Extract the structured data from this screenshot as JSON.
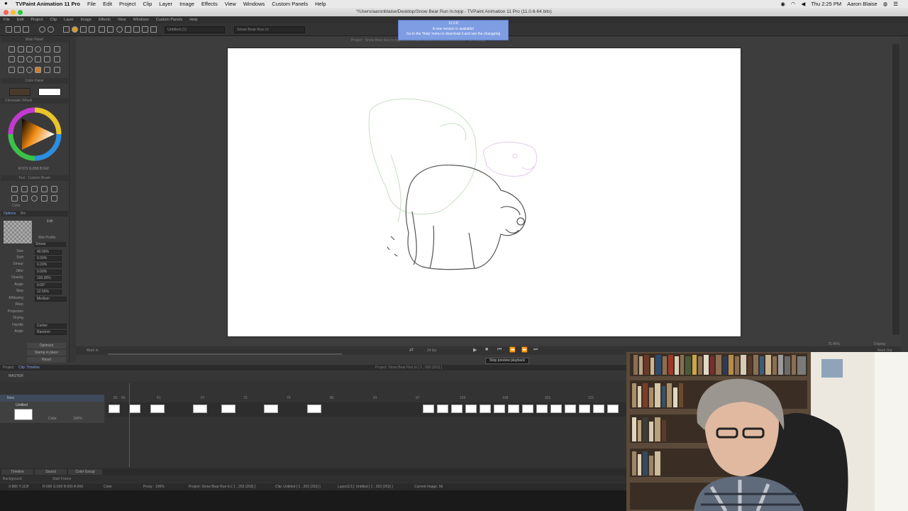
{
  "menubar": {
    "app_name": "TVPaint Animation 11 Pro",
    "items": [
      "File",
      "Edit",
      "Project",
      "Clip",
      "Layer",
      "Image",
      "Effects",
      "View",
      "Windows",
      "Custom Panels",
      "Help"
    ],
    "clock": "Thu 2:25 PM",
    "user": "Aaron Blaise"
  },
  "window": {
    "title": "*/Users/aaronblaise/Desktop/Snow Bear Run In.tvpp - TVPaint Animation 11 Pro (11.0.6-64 bits)"
  },
  "app_menu": [
    "File",
    "Edit",
    "Project",
    "Clip",
    "Layer",
    "Image",
    "Effects",
    "View",
    "Windows",
    "Custom Panels",
    "Help"
  ],
  "toolbar": {
    "layer_field": "Untitled (1)",
    "project_field": "Snow Bear Run In"
  },
  "popup": {
    "version": "11.0.8",
    "line1": "A new version is available!",
    "line2": "Go to the 'Help' menu to download it and see the changelog"
  },
  "left_panel": {
    "main_panel": "Main Panel",
    "color_panel": "Color Panel",
    "chromatic_wheel": "Chromatic Wheel",
    "rgb_readout": "R:073 G:058 B:042",
    "tool_panel": "Tool : Custom Brush",
    "color_label": "Color",
    "options_tab": "Options",
    "bin_tab": "Bin",
    "edit_label": "Edit",
    "wet_profile": "Wet Profile",
    "smear": "Smear",
    "params": [
      {
        "label": "Size",
        "value": "40.00%"
      },
      {
        "label": "Shift",
        "value": "0.00%"
      },
      {
        "label": "Smear",
        "value": "0.20%"
      },
      {
        "label": "Jitter",
        "value": "0.00%"
      },
      {
        "label": "Opacity",
        "value": "100.00%"
      },
      {
        "label": "Angle",
        "value": "0.00°"
      },
      {
        "label": "Step",
        "value": "12.50%"
      }
    ],
    "aaliasing_label": "AAliasing",
    "aaliasing_value": "Medium",
    "warp_label": "Warp",
    "projection_label": "Projection",
    "drying_label": "Drying",
    "handle_label": "Handle",
    "handle_value": "Center",
    "angle2_label": "Angle",
    "angle2_value": "Random",
    "optimize": "Optimize",
    "stamp": "Stamp in place",
    "reset": "Reset"
  },
  "project_path": "Project : Snow Bear Run In.tvpp (/Users/aaronblaise/Desktop/Snow Bear Run In.tvpp)",
  "image_info": "Image: 56",
  "zoom": "75.46%",
  "display": "Display",
  "mark_out": "Mark Out",
  "mark_in": "Mark In",
  "fps": "24 fps",
  "tooltip": "Stop preview playback",
  "timeline": {
    "tab_project": "Project",
    "tab_clip": "Clip: Timeline",
    "master": "MASTER",
    "project_info": "Project: Snow Bear Run In [ 1 , 263 (263) ]",
    "clip_info": "Clip: Untitled [ 1 , 263 (263) ]",
    "layer_info": "Layer(1/1): Untitled [ 1 , 263 (263) ]",
    "current_image": "Current Image: 56",
    "layer_name": "Untitled",
    "color_label": "Color",
    "opacity": "100%",
    "new_label": "New",
    "frame_numbers": [
      "55",
      "56",
      "61",
      "67",
      "73",
      "79",
      "85",
      "91",
      "97",
      "103",
      "109",
      "115",
      "121"
    ],
    "timeline_label": "Timeline",
    "sound_label": "Sound",
    "color_group": "Color Group",
    "background": "Background",
    "start_frame": "Start Frame"
  },
  "statusbar": {
    "coords": "X:865 Y:113f",
    "rgba": "R:000 G:000 B:000 A:000",
    "color": "Color",
    "proxy": "Proxy : 100%",
    "project": "Project: Snow Bear Run In [ 1 , 263 (263) ]",
    "clip": "Clip: Untitled [ 1 , 263 (263) ]",
    "layer": "Layer(1/1): Untitled [ 1 , 263 (263) ]",
    "current": "Current Image: 56"
  },
  "colors": {
    "popup_bg": "#7e9de2",
    "panel_bg": "#3a3a3a",
    "canvas_bg": "#ffffff"
  }
}
